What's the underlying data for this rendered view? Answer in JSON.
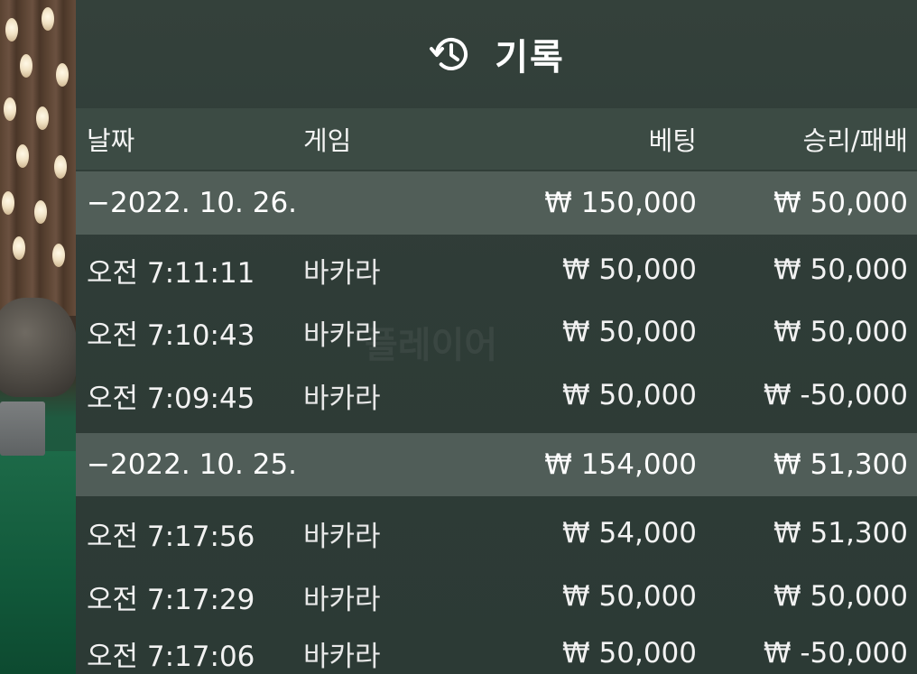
{
  "header": {
    "title": "기록",
    "icon": "history-icon"
  },
  "columns": {
    "date": "날짜",
    "game": "게임",
    "bet": "베팅",
    "win_loss": "승리/패배"
  },
  "background_text": "플레이어",
  "rows": [
    {
      "type": "group",
      "date": "−2022. 10. 26.",
      "game": "",
      "bet": "₩ 150,000",
      "win_loss": "₩ 50,000"
    },
    {
      "type": "item",
      "date": "오전 7:11:11",
      "game": "바카라",
      "bet": "₩ 50,000",
      "win_loss": "₩ 50,000"
    },
    {
      "type": "item",
      "date": "오전 7:10:43",
      "game": "바카라",
      "bet": "₩ 50,000",
      "win_loss": "₩ 50,000"
    },
    {
      "type": "item",
      "date": "오전 7:09:45",
      "game": "바카라",
      "bet": "₩ 50,000",
      "win_loss": "₩ -50,000"
    },
    {
      "type": "group",
      "date": "−2022. 10. 25.",
      "game": "",
      "bet": "₩ 154,000",
      "win_loss": "₩ 51,300"
    },
    {
      "type": "item",
      "date": "오전 7:17:56",
      "game": "바카라",
      "bet": "₩ 54,000",
      "win_loss": "₩ 51,300"
    },
    {
      "type": "item",
      "date": "오전 7:17:29",
      "game": "바카라",
      "bet": "₩ 50,000",
      "win_loss": "₩ 50,000"
    },
    {
      "type": "item",
      "date": "오전 7:17:06",
      "game": "바카라",
      "bet": "₩ 50,000",
      "win_loss": "₩ -50,000"
    }
  ],
  "colors": {
    "panel_bg": "#2f3c37",
    "group_row_bg": "#5f6c66",
    "header_row_bg": "#46554e",
    "text": "#ffffff"
  }
}
